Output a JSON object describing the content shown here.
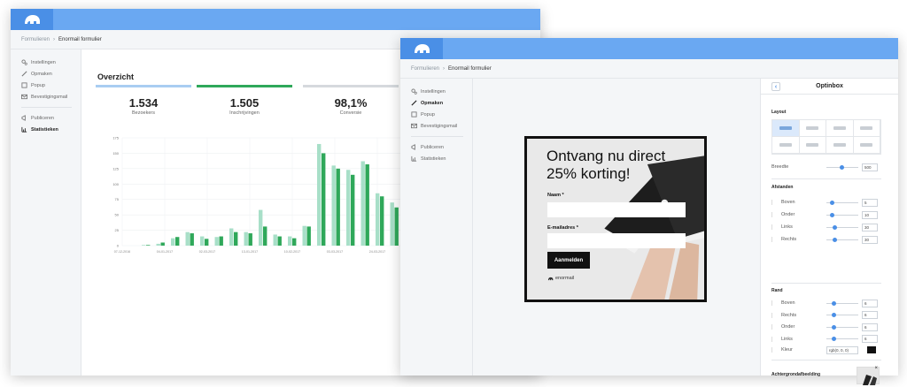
{
  "colors": {
    "accent": "#4a8fe6",
    "topbar": "#6aa8f2",
    "bar_light": "#a8dfc8",
    "bar_dark": "#2fa85a"
  },
  "window1": {
    "breadcrumb": {
      "parent": "Formulieren",
      "separator": "›",
      "current": "Enormail formulier"
    },
    "nav": [
      {
        "label": "Instellingen",
        "icon": "gears-icon"
      },
      {
        "label": "Opmaken",
        "icon": "brush-icon"
      },
      {
        "label": "Popup",
        "icon": "square-icon"
      },
      {
        "label": "Bevestigingsmail",
        "icon": "mail-icon"
      }
    ],
    "nav2": [
      {
        "label": "Publiceren",
        "icon": "megaphone-icon"
      },
      {
        "label": "Statistieken",
        "icon": "chart-icon",
        "active": true
      }
    ],
    "overview_title": "Overzicht",
    "stats": [
      {
        "value": "1.534",
        "label": "Bezoekers",
        "color": "#a9cdf2"
      },
      {
        "value": "1.505",
        "label": "Inschrijvingen",
        "color": "#2fa85a"
      },
      {
        "value": "98,1%",
        "label": "Conversie",
        "color": "#d6d9dd"
      }
    ]
  },
  "chart_data": {
    "type": "bar",
    "yticks": [
      0,
      25,
      50,
      75,
      100,
      125,
      150,
      175
    ],
    "ylim": [
      0,
      175
    ],
    "xtick_labels": [
      "07-12-2016",
      "04-01-2017",
      "02-03-2017",
      "13-01-2017",
      "10-02-2017",
      "03-03-2017",
      "24-03-2017"
    ],
    "series": [
      {
        "values": [
          1,
          3,
          12,
          22,
          15,
          14,
          28,
          22,
          58,
          18,
          15,
          32,
          165,
          130,
          123,
          137,
          85,
          70,
          55
        ]
      },
      {
        "values": [
          1,
          5,
          14,
          20,
          11,
          15,
          22,
          20,
          31,
          15,
          12,
          31,
          150,
          125,
          115,
          132,
          80,
          62,
          52
        ]
      }
    ]
  },
  "window2": {
    "breadcrumb": {
      "parent": "Formulieren",
      "separator": "›",
      "current": "Enormail formulier"
    },
    "nav": [
      {
        "label": "Instellingen",
        "icon": "gears-icon"
      },
      {
        "label": "Opmaken",
        "icon": "brush-icon",
        "active": true
      },
      {
        "label": "Popup",
        "icon": "square-icon"
      },
      {
        "label": "Bevestigingsmail",
        "icon": "mail-icon"
      }
    ],
    "nav2": [
      {
        "label": "Publiceren",
        "icon": "megaphone-icon"
      },
      {
        "label": "Statistieken",
        "icon": "chart-icon"
      }
    ],
    "popup": {
      "title_line1": "Ontvang nu direct",
      "title_line2": "25% korting!",
      "name_label": "Naam *",
      "email_label": "E-mailadres *",
      "submit": "Aanmelden",
      "brand": "enormail"
    },
    "panel": {
      "title": "Optinbox",
      "layout_label": "Layout",
      "breedte_label": "Breedte",
      "breedte_value": "500",
      "afstanden_label": "Afstanden",
      "afstanden": [
        {
          "label": "Boven",
          "value": "5",
          "pos": 0.1
        },
        {
          "label": "Onder",
          "value": "10",
          "pos": 0.12
        },
        {
          "label": "Links",
          "value": "30",
          "pos": 0.2
        },
        {
          "label": "Rechts",
          "value": "30",
          "pos": 0.2
        }
      ],
      "rand_label": "Rand",
      "rand": [
        {
          "label": "Boven",
          "value": "6",
          "pos": 0.18
        },
        {
          "label": "Rechts",
          "value": "6",
          "pos": 0.18
        },
        {
          "label": "Onder",
          "value": "6",
          "pos": 0.18
        },
        {
          "label": "Links",
          "value": "6",
          "pos": 0.18
        }
      ],
      "kleur_label": "Kleur",
      "kleur_value": "rgb(0, 0, 0)",
      "achtergrond_label": "Achtergrondafbeelding"
    }
  }
}
